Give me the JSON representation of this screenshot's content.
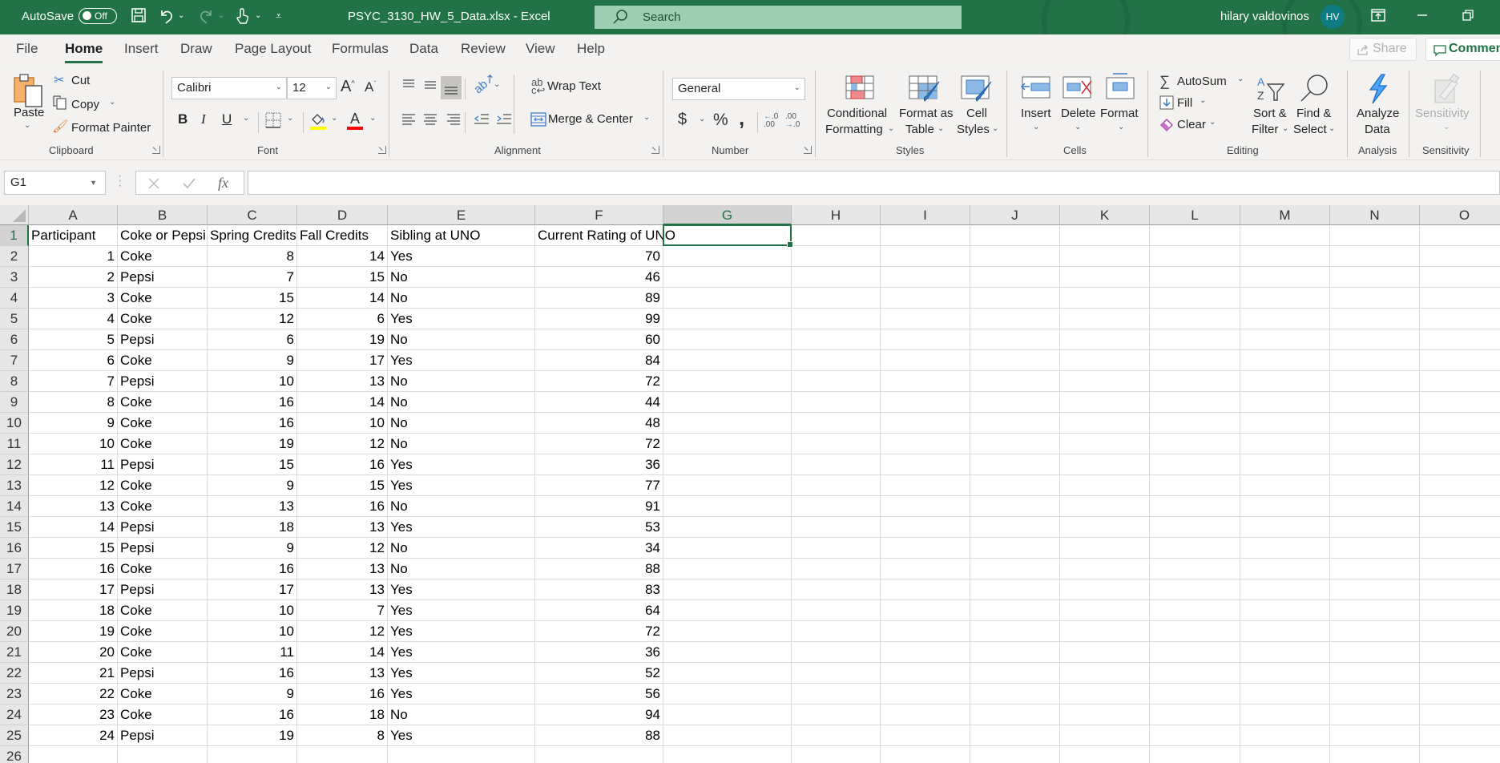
{
  "titlebar": {
    "autosave_label": "AutoSave",
    "autosave_state": "Off",
    "file_title": "PSYC_3130_HW_5_Data.xlsx  -  Excel",
    "search_placeholder": "Search",
    "user_name": "hilary valdovinos",
    "user_initials": "HV",
    "icons": [
      "save-icon",
      "undo-icon",
      "redo-icon",
      "touch-mode-icon",
      "customize-qat-icon",
      "ribbon-display-icon",
      "minimize-icon",
      "restore-icon"
    ]
  },
  "tabs": [
    {
      "label": "File",
      "active": false
    },
    {
      "label": "Home",
      "active": true
    },
    {
      "label": "Insert",
      "active": false
    },
    {
      "label": "Draw",
      "active": false
    },
    {
      "label": "Page Layout",
      "active": false
    },
    {
      "label": "Formulas",
      "active": false
    },
    {
      "label": "Data",
      "active": false
    },
    {
      "label": "Review",
      "active": false
    },
    {
      "label": "View",
      "active": false
    },
    {
      "label": "Help",
      "active": false
    }
  ],
  "share_label": "Share",
  "comments_label": "Comments",
  "ribbon": {
    "clipboard": {
      "group": "Clipboard",
      "paste": "Paste",
      "cut": "Cut",
      "copy": "Copy",
      "format_painter": "Format Painter"
    },
    "font": {
      "group": "Font",
      "font_name": "Calibri",
      "font_size": "12",
      "bold": "B",
      "italic": "I",
      "underline": "U",
      "fill_color": "#ffff00",
      "font_color": "#ff0000"
    },
    "alignment": {
      "group": "Alignment",
      "wrap_text": "Wrap Text",
      "merge_center": "Merge & Center"
    },
    "number": {
      "group": "Number",
      "format": "General",
      "currency": "$",
      "percent": "%",
      "comma": ","
    },
    "styles": {
      "group": "Styles",
      "conditional_formatting": [
        "Conditional",
        "Formatting"
      ],
      "format_as_table": [
        "Format as",
        "Table"
      ],
      "cell_styles": [
        "Cell",
        "Styles"
      ]
    },
    "cells": {
      "group": "Cells",
      "insert": "Insert",
      "delete": "Delete",
      "format": "Format"
    },
    "editing": {
      "group": "Editing",
      "autosum": "AutoSum",
      "fill": "Fill",
      "clear": "Clear",
      "sort_filter": [
        "Sort &",
        "Filter"
      ],
      "find_select": [
        "Find &",
        "Select"
      ]
    },
    "analysis": {
      "group": "Analysis",
      "analyze_data": [
        "Analyze",
        "Data"
      ]
    },
    "sensitivity": {
      "group": "Sensitivity",
      "sensitivity": "Sensitivity"
    }
  },
  "formula_bar": {
    "name_box": "G1",
    "formula": ""
  },
  "sheet": {
    "columns": [
      "A",
      "B",
      "C",
      "D",
      "E",
      "F",
      "G",
      "H",
      "I",
      "J",
      "K",
      "L",
      "M",
      "N",
      "O"
    ],
    "selected_cell": "G1",
    "headers": [
      "Participant",
      "Coke or Pepsi",
      "Spring Credits",
      "Fall Credits",
      "Sibling at UNO",
      "Current Rating of UNO"
    ],
    "rows": [
      [
        1,
        "Coke",
        8,
        14,
        "Yes",
        70
      ],
      [
        2,
        "Pepsi",
        7,
        15,
        "No",
        46
      ],
      [
        3,
        "Coke",
        15,
        14,
        "No",
        89
      ],
      [
        4,
        "Coke",
        12,
        6,
        "Yes",
        99
      ],
      [
        5,
        "Pepsi",
        6,
        19,
        "No",
        60
      ],
      [
        6,
        "Coke",
        9,
        17,
        "Yes",
        84
      ],
      [
        7,
        "Pepsi",
        10,
        13,
        "No",
        72
      ],
      [
        8,
        "Coke",
        16,
        14,
        "No",
        44
      ],
      [
        9,
        "Coke",
        16,
        10,
        "No",
        48
      ],
      [
        10,
        "Coke",
        19,
        12,
        "No",
        72
      ],
      [
        11,
        "Pepsi",
        15,
        16,
        "Yes",
        36
      ],
      [
        12,
        "Coke",
        9,
        15,
        "Yes",
        77
      ],
      [
        13,
        "Coke",
        13,
        16,
        "No",
        91
      ],
      [
        14,
        "Pepsi",
        18,
        13,
        "Yes",
        53
      ],
      [
        15,
        "Pepsi",
        9,
        12,
        "No",
        34
      ],
      [
        16,
        "Coke",
        16,
        13,
        "No",
        88
      ],
      [
        17,
        "Pepsi",
        17,
        13,
        "Yes",
        83
      ],
      [
        18,
        "Coke",
        10,
        7,
        "Yes",
        64
      ],
      [
        19,
        "Coke",
        10,
        12,
        "Yes",
        72
      ],
      [
        20,
        "Coke",
        11,
        14,
        "Yes",
        36
      ],
      [
        21,
        "Pepsi",
        16,
        13,
        "Yes",
        52
      ],
      [
        22,
        "Coke",
        9,
        16,
        "Yes",
        56
      ],
      [
        23,
        "Coke",
        16,
        18,
        "No",
        94
      ],
      [
        24,
        "Pepsi",
        19,
        8,
        "Yes",
        88
      ]
    ],
    "visible_row_count": 26
  }
}
